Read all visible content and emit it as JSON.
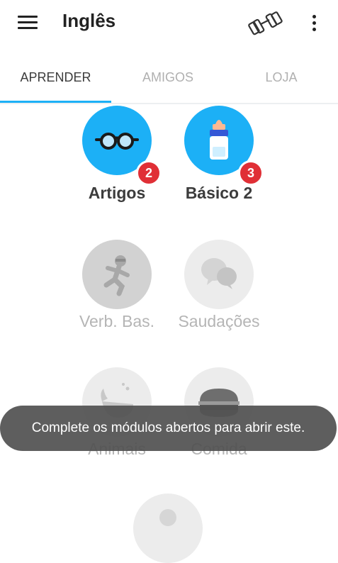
{
  "app_bar": {
    "title": "Inglês",
    "icons": [
      "menu-icon",
      "dumbbell-icon",
      "more-vert-icon"
    ]
  },
  "tabs": [
    {
      "label": "APRENDER",
      "active": true
    },
    {
      "label": "AMIGOS",
      "active": false
    },
    {
      "label": "LOJA",
      "active": false
    }
  ],
  "skills": [
    {
      "label": "Artigos",
      "icon": "glasses-icon",
      "status": "unlocked",
      "badge": "2"
    },
    {
      "label": "Básico 2",
      "icon": "baby-bottle-icon",
      "status": "unlocked",
      "badge": "3"
    },
    {
      "label": "Verb. Bas.",
      "icon": "running-ninja-icon",
      "status": "locked"
    },
    {
      "label": "Saudações",
      "icon": "speech-bubbles-icon",
      "status": "locked"
    },
    {
      "label": "Animais",
      "icon": "whale-icon",
      "status": "locked"
    },
    {
      "label": "Comida",
      "icon": "hamburger-icon",
      "status": "locked"
    },
    {
      "label": "",
      "icon": "locked-skill-icon",
      "status": "locked"
    }
  ],
  "toast": {
    "message": "Complete os módulos abertos para abrir este."
  },
  "colors": {
    "accent": "#1cb0f6",
    "badge": "#e02f36",
    "locked": "#e5e5e5",
    "text_dark": "#3c3c3c",
    "text_muted": "#b0b0b0"
  }
}
